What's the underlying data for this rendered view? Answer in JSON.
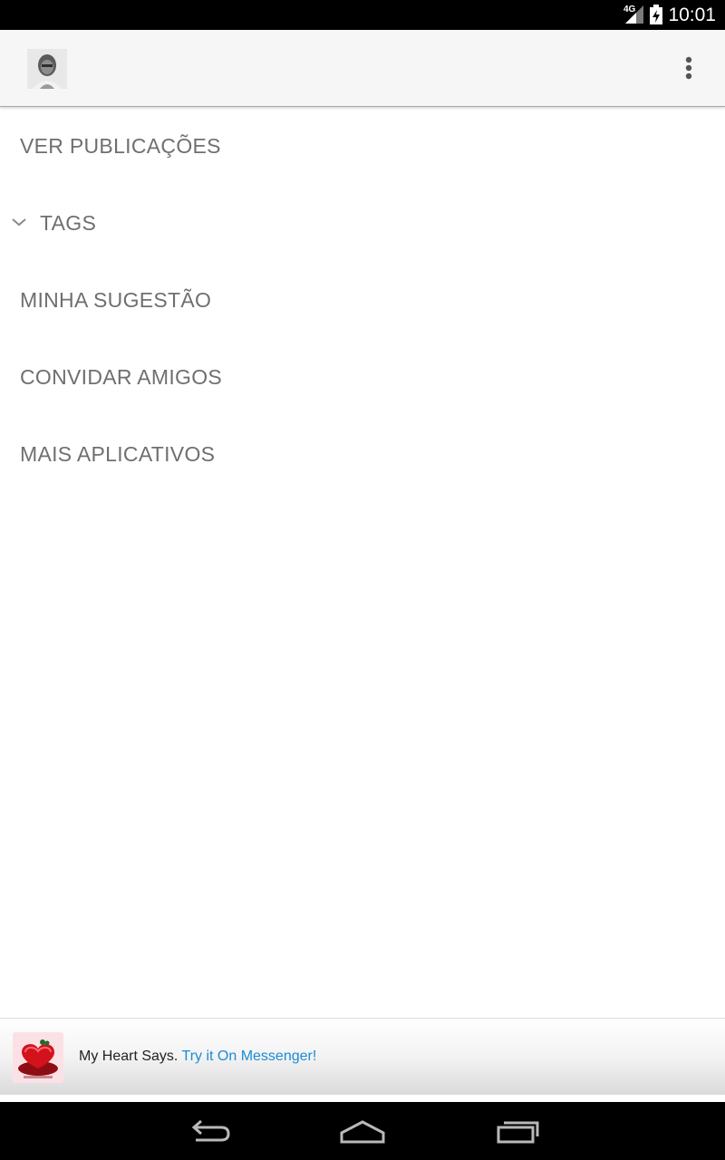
{
  "status_bar": {
    "network": "4G",
    "time": "10:01",
    "icons": [
      "signal-icon",
      "battery-charging-icon"
    ]
  },
  "action_bar": {
    "app_icon": "profile-portrait-icon",
    "overflow_icon": "more-vert-icon"
  },
  "menu": {
    "items": [
      {
        "label": "VER PUBLICAÇÕES"
      },
      {
        "label": "TAGS",
        "icon": "chevron-down-icon"
      },
      {
        "label": "MINHA SUGESTÃO"
      },
      {
        "label": "CONVIDAR AMIGOS"
      },
      {
        "label": "MAIS APLICATIVOS"
      }
    ]
  },
  "ad": {
    "thumb_icon": "heart-box-icon",
    "text": "My Heart Says.",
    "cta": "Try it On Messenger!"
  },
  "nav_bar": {
    "icons": [
      "back-icon",
      "home-icon",
      "recent-apps-icon"
    ]
  },
  "colors": {
    "menu_text": "#6f6f6f",
    "ad_cta": "#1a8bd6",
    "action_bar_bg": "#f6f6f6"
  }
}
